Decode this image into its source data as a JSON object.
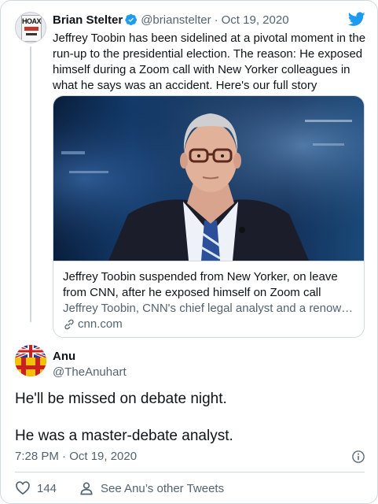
{
  "tweet": {
    "author_name": "Brian Stelter",
    "author_handle": "@brianstelter",
    "date": "Oct 19, 2020",
    "avatar_text": "HOAX",
    "text": "Jeffrey Toobin has been sidelined at a pivotal moment in the run-up to the presidential election. The reason: He exposed himself during a Zoom call with New Yorker colleagues in what he says was an accident. Here's our full story",
    "link_card": {
      "title": "Jeffrey Toobin suspended from New Yorker, on leave from CNN, after he exposed himself on Zoom call",
      "description": "Jeffrey Toobin, CNN's chief legal analyst and a renowned r...",
      "domain": "cnn.com"
    }
  },
  "reply": {
    "author_name": "Anu",
    "author_handle": "@TheAnuhart",
    "lines": [
      "He'll be missed on debate night.",
      "He was a master-debate analyst."
    ],
    "time": "7:28 PM · Oct 19, 2020",
    "likes": "144",
    "see_other": "See Anu’s other Tweets"
  },
  "icons": {
    "verified": "verified-badge-icon",
    "brand": "twitter-bird-icon",
    "link": "link-icon",
    "info": "info-icon",
    "like": "heart-icon",
    "user": "person-icon"
  },
  "colors": {
    "brand_blue": "#1d9bf0",
    "text": "#0f1419",
    "muted": "#536471",
    "border": "#cfd9de"
  }
}
